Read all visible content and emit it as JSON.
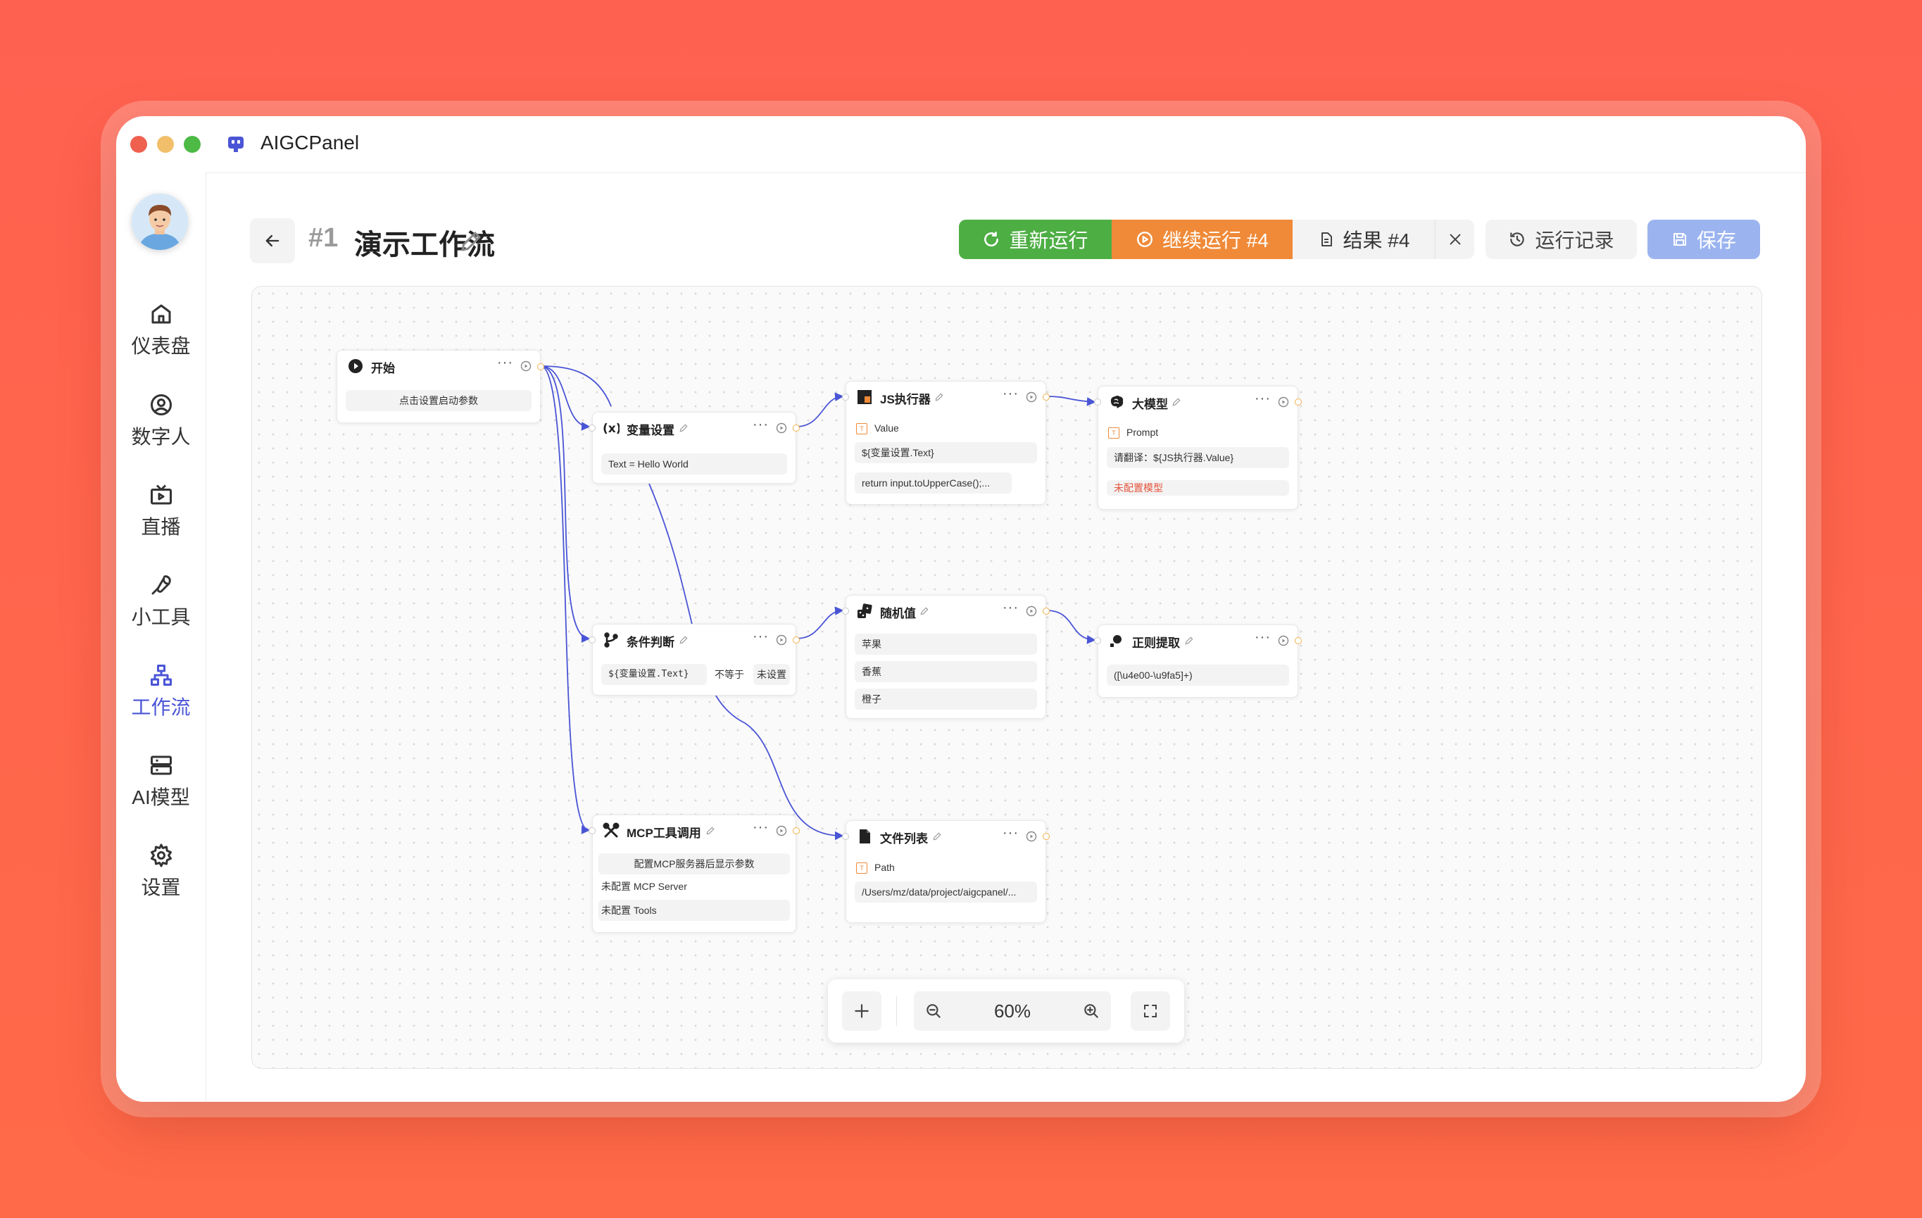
{
  "app": {
    "title": "AIGCPanel"
  },
  "sidebar": {
    "items": [
      {
        "label": "仪表盘",
        "icon": "home-icon"
      },
      {
        "label": "数字人",
        "icon": "user-circle-icon"
      },
      {
        "label": "直播",
        "icon": "tv-icon"
      },
      {
        "label": "小工具",
        "icon": "wrench-icon"
      },
      {
        "label": "工作流",
        "icon": "workflow-icon",
        "active": true
      },
      {
        "label": "AI模型",
        "icon": "server-icon"
      },
      {
        "label": "设置",
        "icon": "gear-icon"
      }
    ]
  },
  "header": {
    "workflow_id": "#1",
    "workflow_name": "演示工作流"
  },
  "toolbar": {
    "rerun_label": "重新运行",
    "continue_label": "继续运行 #4",
    "result_label": "结果 #4",
    "history_label": "运行记录",
    "save_label": "保存"
  },
  "nodes": {
    "start": {
      "title": "开始",
      "body": "点击设置启动参数"
    },
    "variable": {
      "title": "变量设置",
      "body": "Text = Hello World"
    },
    "js": {
      "title": "JS执行器",
      "param": "Value",
      "value": "${变量设置.Text}",
      "code": "return input.toUpperCase();..."
    },
    "llm": {
      "title": "大模型",
      "param": "Prompt",
      "value": "请翻译：${JS执行器.Value}",
      "warning": "未配置模型"
    },
    "condition": {
      "title": "条件判断",
      "left": "${变量设置.Text}",
      "op": "不等于",
      "right": "未设置"
    },
    "random": {
      "title": "随机值",
      "options": [
        "苹果",
        "香蕉",
        "橙子"
      ]
    },
    "regex": {
      "title": "正则提取",
      "pattern": "([\\u4e00-\\u9fa5]+)"
    },
    "mcp": {
      "title": "MCP工具调用",
      "hint": "配置MCP服务器后显示参数",
      "server": "未配置 MCP Server",
      "tools": "未配置 Tools"
    },
    "files": {
      "title": "文件列表",
      "param": "Path",
      "value": "/Users/mz/data/project/aigcpanel/..."
    }
  },
  "zoom": {
    "level": "60%"
  },
  "colors": {
    "accent": "#4a55d6",
    "rerun": "#4dae44",
    "continue": "#f08a38",
    "save": "#9bb4f0",
    "edge": "#4a55d6"
  }
}
